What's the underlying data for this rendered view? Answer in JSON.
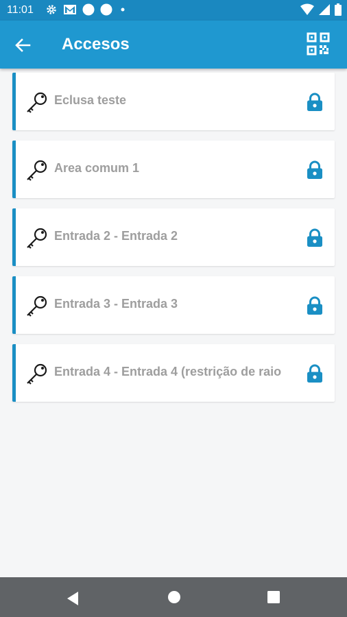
{
  "status_bar": {
    "time": "11:01",
    "left_icons": [
      "settings-icon",
      "gmail-icon",
      "circle-icon",
      "circle-icon",
      "dot-icon"
    ],
    "right_icons": [
      "wifi-icon",
      "signal-icon",
      "battery-icon"
    ]
  },
  "app_bar": {
    "title": "Accesos",
    "back_icon": "arrow-left-icon",
    "action_icon": "qr-code-icon",
    "color": "#1f98d0"
  },
  "access_list": {
    "accent_color": "#1a8fc4",
    "items": [
      {
        "label": "Eclusa  teste",
        "icon": "key-icon",
        "status_icon": "lock-icon"
      },
      {
        "label": "Area comum 1",
        "icon": "key-icon",
        "status_icon": "lock-icon"
      },
      {
        "label": "Entrada 2 - Entrada 2",
        "icon": "key-icon",
        "status_icon": "lock-icon"
      },
      {
        "label": "Entrada 3 - Entrada 3",
        "icon": "key-icon",
        "status_icon": "lock-icon"
      },
      {
        "label": "Entrada 4 - Entrada 4 (restrição de raio",
        "icon": "key-icon",
        "status_icon": "lock-icon"
      }
    ]
  },
  "nav_bar": {
    "buttons": [
      "back-triangle-icon",
      "home-circle-icon",
      "recents-square-icon"
    ]
  }
}
